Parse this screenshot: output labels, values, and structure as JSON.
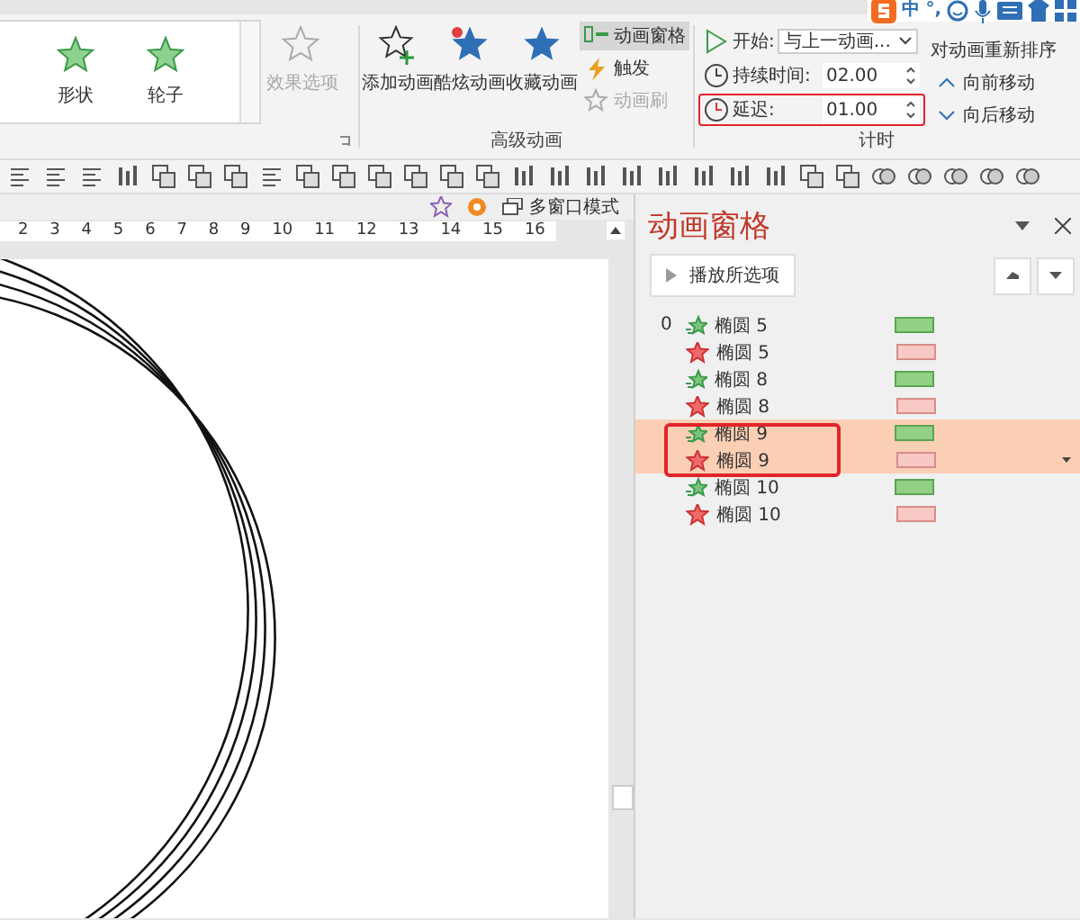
{
  "ribbon": {
    "gallery": [
      {
        "label": "形状"
      },
      {
        "label": "轮子"
      }
    ],
    "effect_options": {
      "label": "效果选项",
      "disabled": true
    },
    "advanced": {
      "buttons": [
        {
          "label": "添加动画",
          "kind": "add"
        },
        {
          "label": "酷炫动画",
          "kind": "cool"
        },
        {
          "label": "收藏动画",
          "kind": "fav"
        }
      ],
      "small": [
        {
          "label": "动画窗格",
          "kind": "pane",
          "selected": true,
          "disabled": false
        },
        {
          "label": "触发",
          "kind": "trigger",
          "selected": false,
          "disabled": false
        },
        {
          "label": "动画刷",
          "kind": "brush",
          "selected": false,
          "disabled": true
        }
      ],
      "group_label": "高级动画"
    },
    "timing": {
      "rows": [
        {
          "label": "开始:",
          "value": "与上一动画...",
          "kind": "dropdown",
          "outlined": false
        },
        {
          "label": "持续时间:",
          "value": "02.00",
          "kind": "spinner",
          "outlined": false
        },
        {
          "label": "延迟:",
          "value": "01.00",
          "kind": "spinner",
          "outlined": true
        }
      ],
      "group_label": "计时"
    },
    "reorder": {
      "title": "对动画重新排序",
      "buttons": [
        {
          "label": "向前移动",
          "kind": "up"
        },
        {
          "label": "向后移动",
          "kind": "down"
        }
      ]
    },
    "ime": {
      "items": [
        "中",
        "°,"
      ]
    }
  },
  "view_bar": {
    "label": "多窗口模式"
  },
  "ruler": {
    "ticks": [
      "2",
      "3",
      "4",
      "5",
      "6",
      "7",
      "8",
      "9",
      "10",
      "11",
      "12",
      "13",
      "14",
      "15",
      "16"
    ]
  },
  "pane": {
    "title": "动画窗格",
    "play_button": "播放所选项",
    "items": [
      {
        "index": "0",
        "name": "椭圆 5",
        "kind": "entrance",
        "selected": false,
        "annotated": false
      },
      {
        "name": "椭圆 5",
        "kind": "exit",
        "selected": false,
        "annotated": false
      },
      {
        "name": "椭圆 8",
        "kind": "entrance",
        "selected": false,
        "annotated": false
      },
      {
        "name": "椭圆 8",
        "kind": "exit",
        "selected": false,
        "annotated": false
      },
      {
        "name": "椭圆 9",
        "kind": "entrance",
        "selected": true,
        "annotated": true
      },
      {
        "name": "椭圆 9",
        "kind": "exit",
        "selected": true,
        "annotated": true
      },
      {
        "name": "椭圆 10",
        "kind": "entrance",
        "selected": false,
        "annotated": false
      },
      {
        "name": "椭圆 10",
        "kind": "exit",
        "selected": false,
        "annotated": false
      }
    ]
  }
}
